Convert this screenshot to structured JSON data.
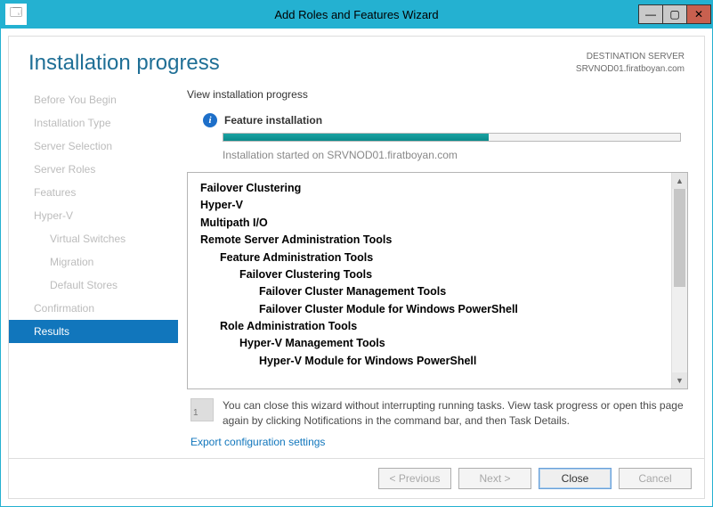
{
  "titlebar": {
    "title": "Add Roles and Features Wizard"
  },
  "header": {
    "title": "Installation progress",
    "destination_label": "DESTINATION SERVER",
    "destination_server": "SRVNOD01.firatboyan.com"
  },
  "sidebar": {
    "items": [
      {
        "label": "Before You Begin",
        "active": false,
        "sub": false
      },
      {
        "label": "Installation Type",
        "active": false,
        "sub": false
      },
      {
        "label": "Server Selection",
        "active": false,
        "sub": false
      },
      {
        "label": "Server Roles",
        "active": false,
        "sub": false
      },
      {
        "label": "Features",
        "active": false,
        "sub": false
      },
      {
        "label": "Hyper-V",
        "active": false,
        "sub": false
      },
      {
        "label": "Virtual Switches",
        "active": false,
        "sub": true
      },
      {
        "label": "Migration",
        "active": false,
        "sub": true
      },
      {
        "label": "Default Stores",
        "active": false,
        "sub": true
      },
      {
        "label": "Confirmation",
        "active": false,
        "sub": false
      },
      {
        "label": "Results",
        "active": true,
        "sub": false
      }
    ]
  },
  "main": {
    "view_label": "View installation progress",
    "status_text": "Feature installation",
    "progress_percent": 58,
    "install_msg": "Installation started on SRVNOD01.firatboyan.com",
    "tree": [
      {
        "label": "Failover Clustering",
        "level": 0
      },
      {
        "label": "Hyper-V",
        "level": 0
      },
      {
        "label": "Multipath I/O",
        "level": 0
      },
      {
        "label": "Remote Server Administration Tools",
        "level": 0
      },
      {
        "label": "Feature Administration Tools",
        "level": 1
      },
      {
        "label": "Failover Clustering Tools",
        "level": 2
      },
      {
        "label": "Failover Cluster Management Tools",
        "level": 3
      },
      {
        "label": "Failover Cluster Module for Windows PowerShell",
        "level": 3
      },
      {
        "label": "Role Administration Tools",
        "level": 1
      },
      {
        "label": "Hyper-V Management Tools",
        "level": 2
      },
      {
        "label": "Hyper-V Module for Windows PowerShell",
        "level": 3
      }
    ],
    "note_text": "You can close this wizard without interrupting running tasks. View task progress or open this page again by clicking Notifications in the command bar, and then Task Details.",
    "note_badge": "1",
    "export_link": "Export configuration settings"
  },
  "footer": {
    "previous": "< Previous",
    "next": "Next >",
    "close": "Close",
    "cancel": "Cancel"
  }
}
